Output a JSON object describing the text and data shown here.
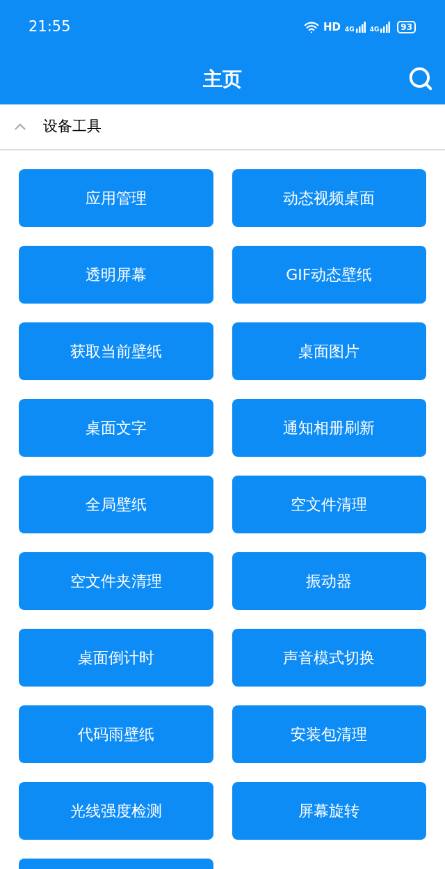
{
  "status_bar": {
    "time": "21:55",
    "hd": "HD",
    "signals": [
      "4G",
      "4G"
    ],
    "battery": "93"
  },
  "header": {
    "title": "主页"
  },
  "section": {
    "title": "设备工具",
    "expanded": true
  },
  "tools": [
    {
      "label": "应用管理"
    },
    {
      "label": "动态视频桌面"
    },
    {
      "label": "透明屏幕"
    },
    {
      "label": "GIF动态壁纸"
    },
    {
      "label": "获取当前壁纸"
    },
    {
      "label": "桌面图片"
    },
    {
      "label": "桌面文字"
    },
    {
      "label": "通知相册刷新"
    },
    {
      "label": "全局壁纸"
    },
    {
      "label": "空文件清理"
    },
    {
      "label": "空文件夹清理"
    },
    {
      "label": "振动器"
    },
    {
      "label": "桌面倒计时"
    },
    {
      "label": "声音模式切换"
    },
    {
      "label": "代码雨壁纸"
    },
    {
      "label": "安装包清理"
    },
    {
      "label": "光线强度检测"
    },
    {
      "label": "屏幕旋转"
    }
  ],
  "more_tools_below": true
}
